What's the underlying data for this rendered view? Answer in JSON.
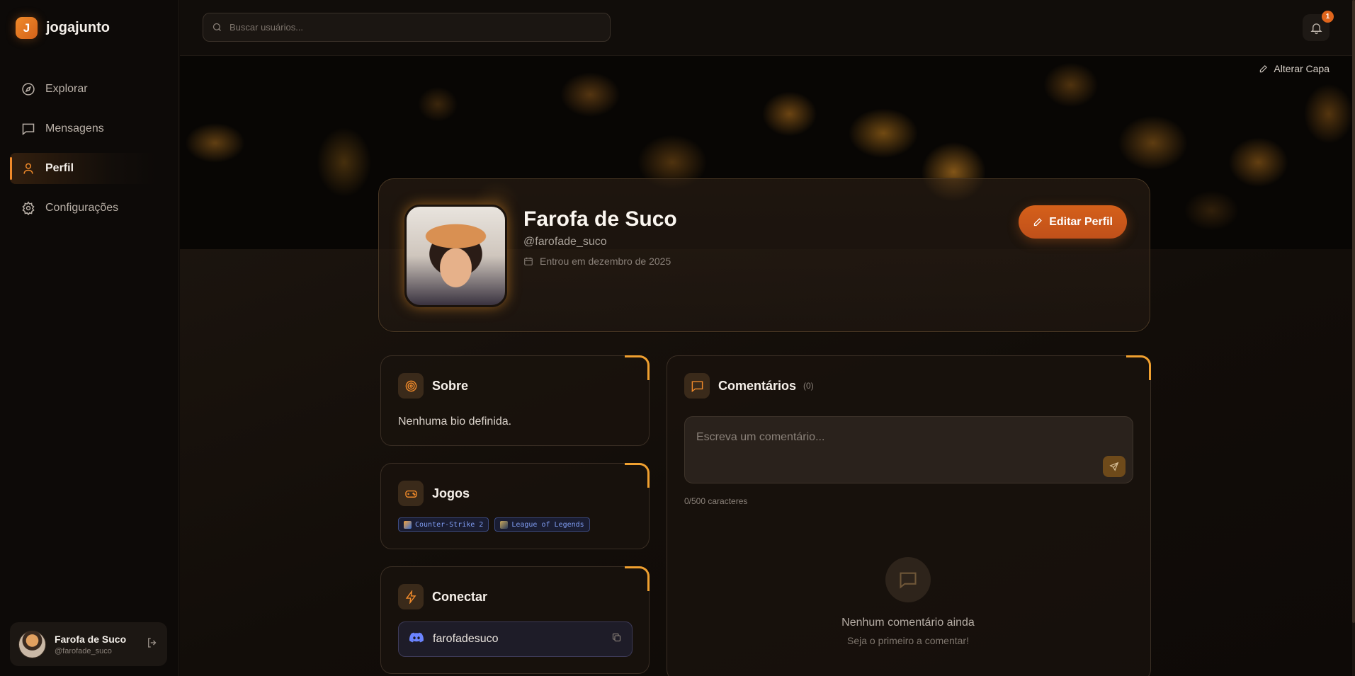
{
  "brand": {
    "logo_letter": "J",
    "name": "jogajunto"
  },
  "nav": {
    "items": [
      {
        "label": "Explorar",
        "icon": "compass-icon"
      },
      {
        "label": "Mensagens",
        "icon": "message-icon"
      },
      {
        "label": "Perfil",
        "icon": "user-icon",
        "active": true
      },
      {
        "label": "Configurações",
        "icon": "gear-icon"
      }
    ]
  },
  "sidebar_user": {
    "name": "Farofa de Suco",
    "handle": "@farofade_suco"
  },
  "search": {
    "placeholder": "Buscar usuários..."
  },
  "notifications": {
    "count": "1"
  },
  "cover": {
    "change_label": "Alterar Capa"
  },
  "profile": {
    "name": "Farofa de Suco",
    "handle": "@farofade_suco",
    "joined": "Entrou em dezembro de 2025",
    "edit_label": "Editar Perfil"
  },
  "about": {
    "title": "Sobre",
    "bio": "Nenhuma bio definida."
  },
  "games": {
    "title": "Jogos",
    "items": [
      "Counter-Strike 2",
      "League of Legends"
    ]
  },
  "connect": {
    "title": "Conectar",
    "discord": "farofadesuco"
  },
  "comments": {
    "title": "Comentários",
    "count": "(0)",
    "placeholder": "Escreva um comentário...",
    "char_count": "0/500 caracteres",
    "empty_title": "Nenhum comentário ainda",
    "empty_sub": "Seja o primeiro a comentar!"
  },
  "colors": {
    "accent": "#f08a2a",
    "button": "#c9561a",
    "background": "#0f0b08"
  }
}
